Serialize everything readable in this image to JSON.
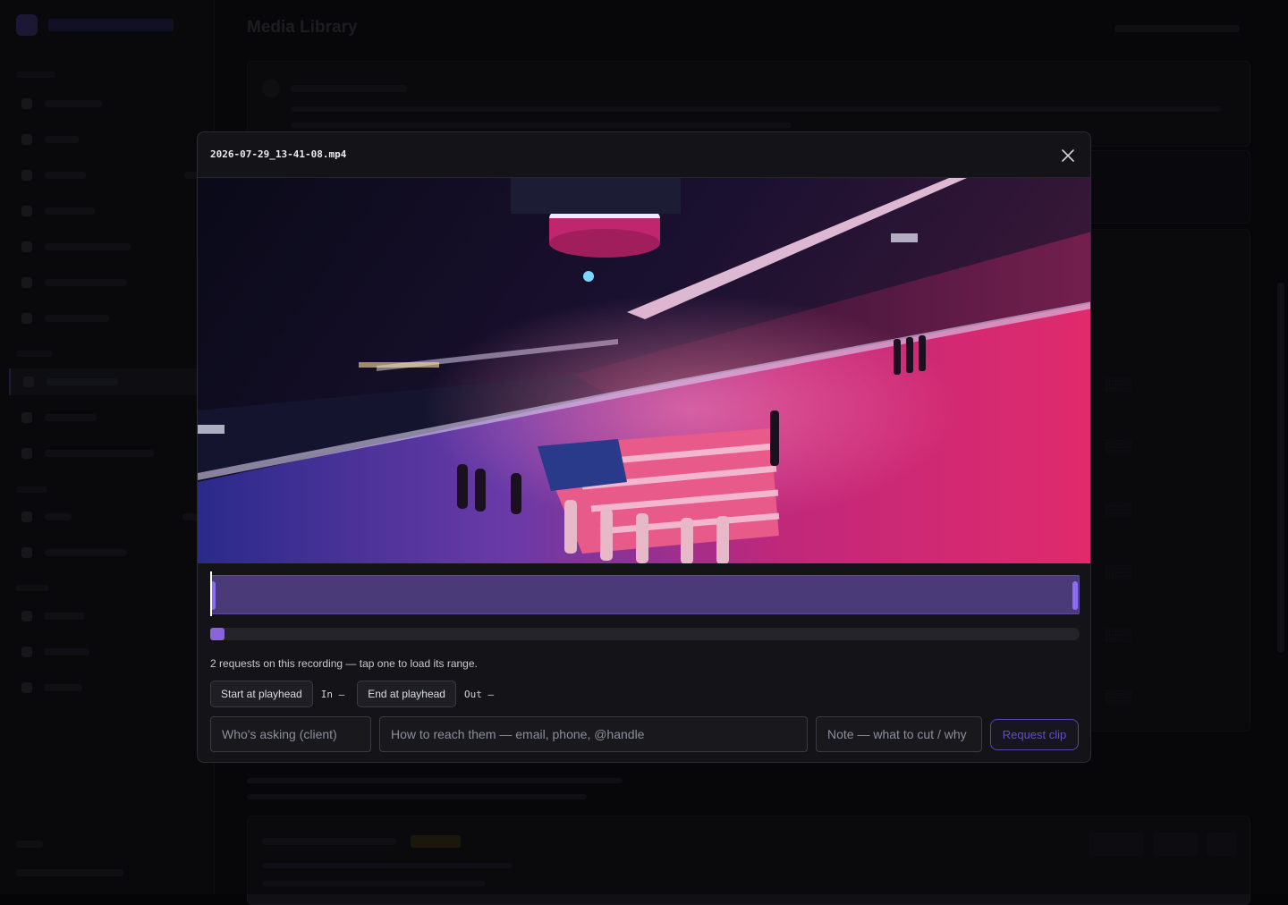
{
  "modal": {
    "title": "2026-07-29_13-41-08.mp4",
    "close_icon": "close-icon",
    "trim": {
      "in_fraction": 0.0,
      "out_fraction": 1.0,
      "playhead_fraction": 0.0
    },
    "scrubber": {
      "position_fraction": 0.0
    },
    "requests_text": "2 requests on this recording — tap one to load its range.",
    "controls": {
      "start_label": "Start at playhead",
      "in_label": "In –",
      "end_label": "End at playhead",
      "out_label": "Out –"
    },
    "form": {
      "client_placeholder": "Who's asking (client)",
      "contact_placeholder": "How to reach them — email, phone, @handle",
      "note_placeholder": "Note — what to cut / why",
      "submit_label": "Request clip"
    },
    "colors": {
      "accent": "#8c6cf4",
      "trim_fill": "#4a3a78",
      "submit_text": "#6250c4"
    }
  },
  "background": {
    "page_title": "Media Library"
  }
}
